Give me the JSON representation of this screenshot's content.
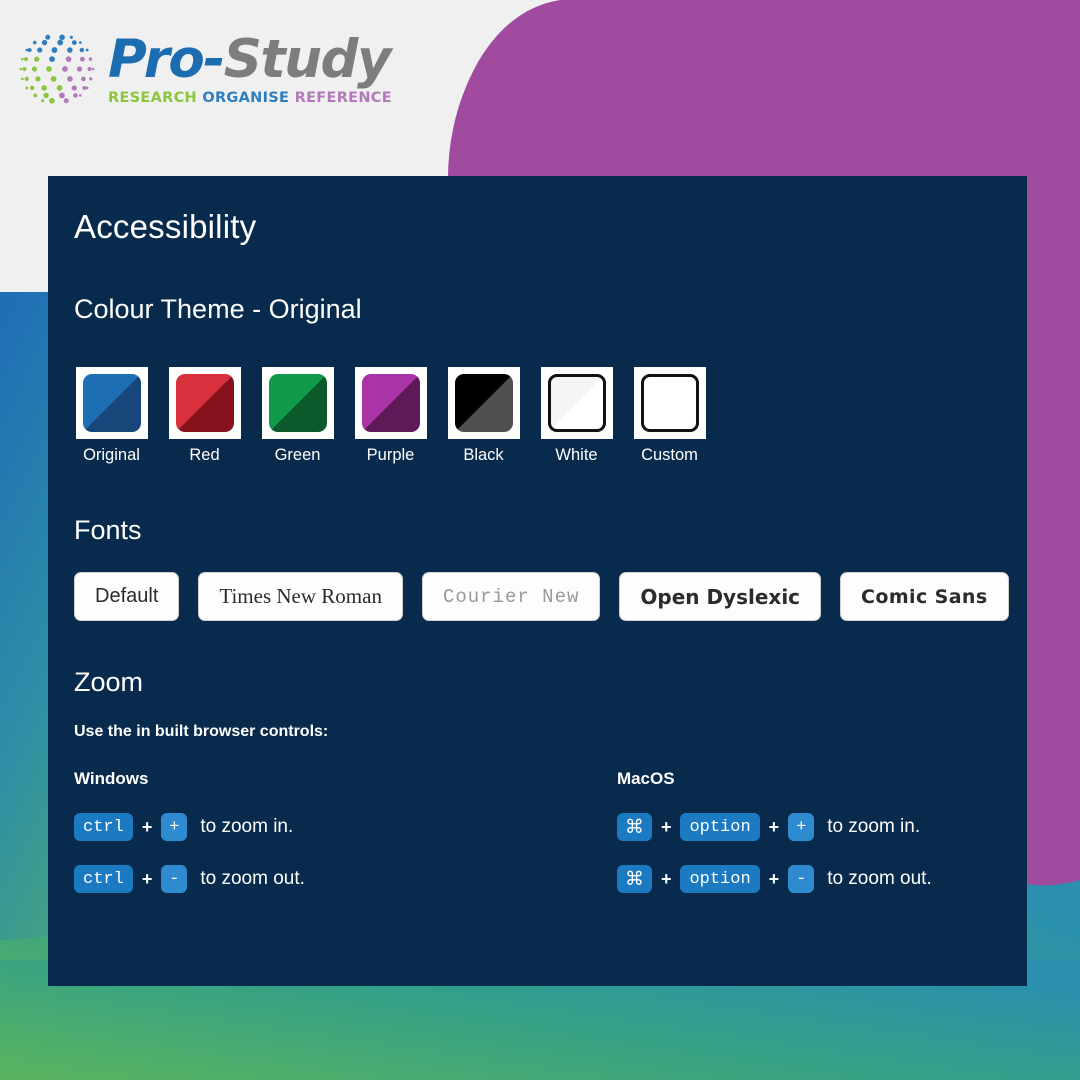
{
  "brand": {
    "globe_icon": "globe-dots-icon",
    "wordmark_pro": "Pro",
    "wordmark_dash": "-",
    "wordmark_study": "Study",
    "tagline_research": "RESEARCH",
    "tagline_organise": "ORGANISE",
    "tagline_reference": "REFERENCE",
    "colors": {
      "pro_blue": "#1b6cb0",
      "study_grey": "#7d7d7d",
      "research_green": "#8cc63f",
      "organise_blue": "#2e7fc1",
      "reference_purple": "#b07bb8"
    }
  },
  "panel": {
    "title": "Accessibility",
    "background": "#082a4d"
  },
  "colour_theme": {
    "heading": "Colour Theme - Original",
    "selected": "Original",
    "swatches": [
      {
        "label": "Original",
        "light": "#1f6fb5",
        "dark": "#17477a",
        "outlined": false
      },
      {
        "label": "Red",
        "light": "#d8303c",
        "dark": "#85121c",
        "outlined": false
      },
      {
        "label": "Green",
        "light": "#129a4c",
        "dark": "#0c5a2c",
        "outlined": false
      },
      {
        "label": "Purple",
        "light": "#aa33a6",
        "dark": "#5e1a58",
        "outlined": false
      },
      {
        "label": "Black",
        "light": "#000000",
        "dark": "#4f4f4f",
        "outlined": false
      },
      {
        "label": "White",
        "light": "#f5f5f5",
        "dark": "#ffffff",
        "outlined": true
      },
      {
        "label": "Custom",
        "light": "#ffffff",
        "dark": "#ffffff",
        "outlined": true
      }
    ]
  },
  "fonts": {
    "heading": "Fonts",
    "options": [
      {
        "label": "Default",
        "style": "ff-default"
      },
      {
        "label": "Times New Roman",
        "style": "ff-serif"
      },
      {
        "label": "Courier New",
        "style": "ff-mono"
      },
      {
        "label": "Open Dyslexic",
        "style": "ff-dyslexic"
      },
      {
        "label": "Comic Sans",
        "style": "ff-comic"
      }
    ]
  },
  "zoom": {
    "heading": "Zoom",
    "intro": "Use the in built browser controls:",
    "key_badge_color": "#1b7ac2",
    "windows": {
      "platform": "Windows",
      "rows": [
        {
          "keys": [
            "ctrl",
            "+"
          ],
          "text": "to zoom in."
        },
        {
          "keys": [
            "ctrl",
            "-"
          ],
          "text": "to zoom out."
        }
      ]
    },
    "macos": {
      "platform": "MacOS",
      "rows": [
        {
          "keys": [
            "⌘",
            "option",
            "+"
          ],
          "text": "to zoom in."
        },
        {
          "keys": [
            "⌘",
            "option",
            "-"
          ],
          "text": "to zoom out."
        }
      ]
    },
    "separator": "+"
  },
  "decor": {
    "purple_blob": "#a04ba0",
    "gradient_start": "#59b55f",
    "gradient_end": "#2a90ad",
    "page_background": "#f0f0f0"
  }
}
